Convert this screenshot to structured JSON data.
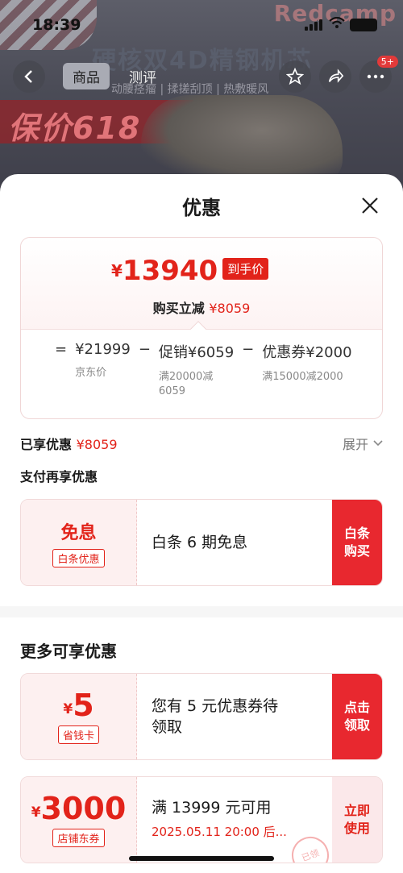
{
  "status_bar": {
    "time": "18:39",
    "battery_indicator": "full"
  },
  "background": {
    "brand": "Redcamp",
    "headline": "硬核双4D精钢机芯",
    "subline": "动腰痉瘤  |  揉搓刮顶  |  热敷暖风",
    "promo": "保价618"
  },
  "nav": {
    "tabs": [
      "商品",
      "测评"
    ],
    "active_tab": 0,
    "badge": "5+",
    "icons": [
      "back-arrow-icon",
      "star-icon",
      "share-icon",
      "more-icon"
    ]
  },
  "sheet": {
    "title": "优惠",
    "price": {
      "currency": "¥",
      "final": "13940",
      "final_tag": "到手价",
      "reduce_label": "购买立减",
      "reduce_amount": "¥8059"
    },
    "formula": [
      {
        "op": "=",
        "value": "¥21999",
        "sub": "京东价"
      },
      {
        "op": "−",
        "value": "促销¥6059",
        "sub": "满20000减\n6059"
      },
      {
        "op": "−",
        "value": "优惠券¥2000",
        "sub": "满15000减2000"
      }
    ],
    "enjoyed_label": "已享优惠",
    "enjoyed_amount": "¥8059",
    "expand_label": "展开",
    "pay_more_label": "支付再享优惠",
    "pay_coupon": {
      "big": "免息",
      "label": "白条优惠",
      "desc": "白条 6 期免息",
      "action": "白条\n购买"
    },
    "more_title": "更多可享优惠",
    "coupons": [
      {
        "currency": "¥",
        "amount": "5",
        "label": "省钱卡",
        "desc_line1": "您有 5 元优惠券待",
        "desc_line2": "领取",
        "action": "点击\n领取"
      },
      {
        "currency": "¥",
        "amount": "3000",
        "label": "店铺东券",
        "desc_line1": "满 13999 元可用",
        "expiry": "2025.05.11 20:00 后...",
        "action": "立即\n使用",
        "stamp": "已领"
      }
    ]
  },
  "colors": {
    "accent": "#e2231a",
    "button": "#e8282f",
    "soft": "#fdf0f0"
  }
}
